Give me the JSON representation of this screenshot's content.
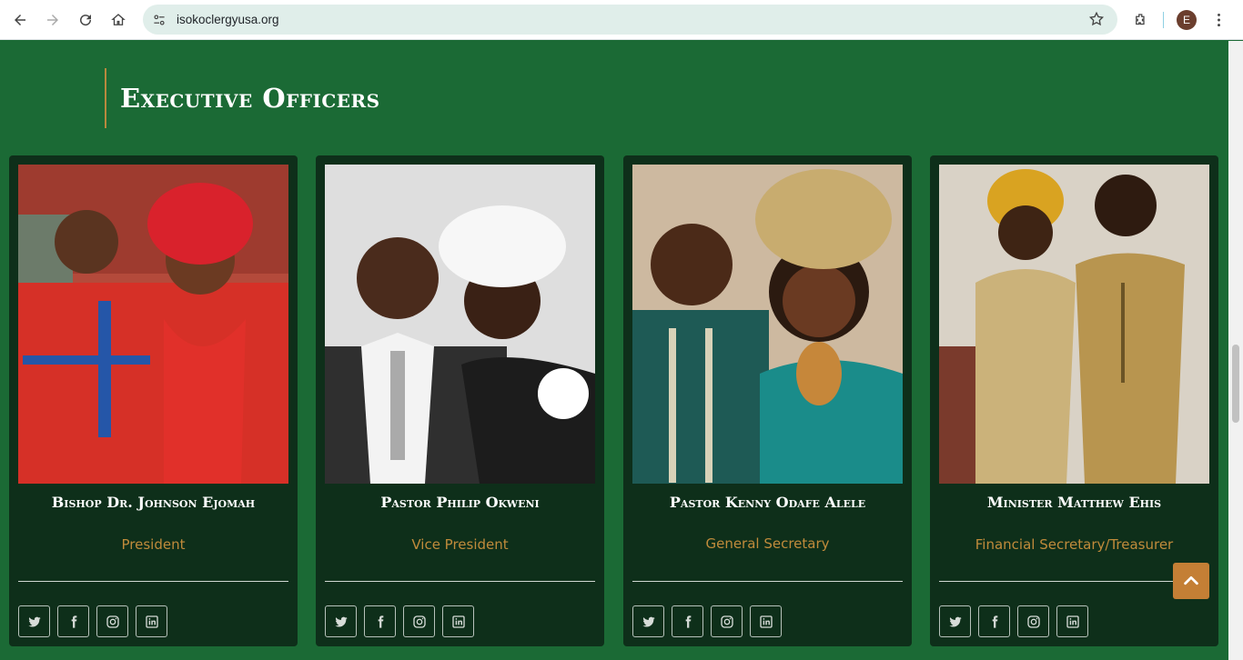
{
  "browser": {
    "url": "isokoclergyusa.org",
    "profile_initial": "E",
    "icons": [
      "back-icon",
      "forward-icon",
      "reload-icon",
      "home-icon",
      "site-settings-icon",
      "bookmark-star-icon",
      "extensions-icon",
      "profile-avatar",
      "menu-icon"
    ]
  },
  "section": {
    "title": "Executive Officers"
  },
  "officers": [
    {
      "name": "Bishop Dr. Johnson Ejomah",
      "role": "President"
    },
    {
      "name": "Pastor Philip Okweni",
      "role": "Vice President"
    },
    {
      "name": "Pastor Kenny Odafe Alele",
      "role": "General Secretary"
    },
    {
      "name": "Minister Matthew Ehis",
      "role": "Financial Secretary/Treasurer"
    }
  ],
  "social_icons": [
    "twitter-icon",
    "facebook-icon",
    "instagram-icon",
    "linkedin-icon"
  ],
  "colors": {
    "page_bg": "#1b6a35",
    "card_bg": "#0e2f1a",
    "accent_gold": "#c08b3b",
    "scroll_top_button": "#c47f35"
  }
}
